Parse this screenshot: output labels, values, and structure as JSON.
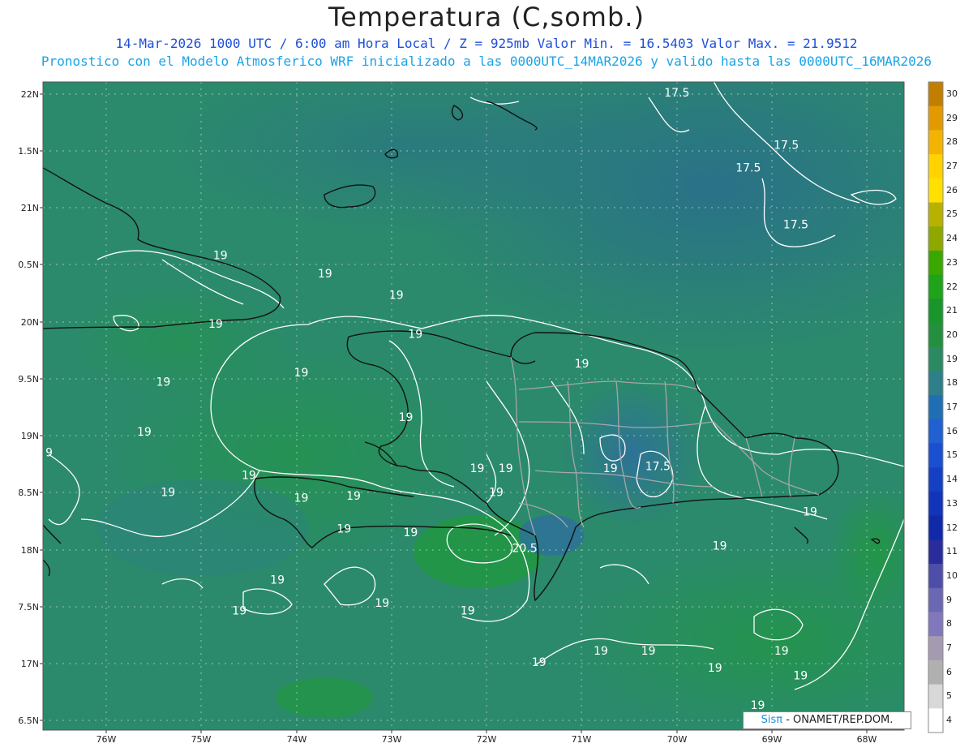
{
  "header": {
    "title": "Temperatura (C,somb.)",
    "subtitle_line1": "14-Mar-2026  1000 UTC / 6:00 am Hora Local / Z = 925mb    Valor Min. = 16.5403  Valor Max. = 21.9512",
    "subtitle_line2": "Pronostico con el Modelo Atmosferico WRF inicializado a las 0000UTC_14MAR2026 y valido hasta las  0000UTC_16MAR2026"
  },
  "map": {
    "lat_labels": [
      "22N",
      "1.5N",
      "21N",
      "0.5N",
      "20N",
      "9.5N",
      "19N",
      "8.5N",
      "18N",
      "7.5N",
      "17N",
      "6.5N"
    ],
    "lon_labels": [
      "76W",
      "75W",
      "74W",
      "73W",
      "72W",
      "71W",
      "70W",
      "69W",
      "68W"
    ],
    "contour_labels": [
      {
        "text": "17.5",
        "lon": -70.0,
        "lat": 21.98
      },
      {
        "text": "17.5",
        "lon": -68.85,
        "lat": 21.52
      },
      {
        "text": "17.5",
        "lon": -69.25,
        "lat": 21.32
      },
      {
        "text": "17.5",
        "lon": -68.75,
        "lat": 20.82
      },
      {
        "text": "19",
        "lon": -74.8,
        "lat": 20.55
      },
      {
        "text": "19",
        "lon": -73.7,
        "lat": 20.39
      },
      {
        "text": "19",
        "lon": -72.95,
        "lat": 20.2
      },
      {
        "text": "19",
        "lon": -74.85,
        "lat": 19.95
      },
      {
        "text": "19",
        "lon": -72.75,
        "lat": 19.86
      },
      {
        "text": "19",
        "lon": -71.0,
        "lat": 19.6
      },
      {
        "text": "19",
        "lon": -73.95,
        "lat": 19.52
      },
      {
        "text": "19",
        "lon": -75.4,
        "lat": 19.44
      },
      {
        "text": "19",
        "lon": -72.85,
        "lat": 19.13
      },
      {
        "text": "19",
        "lon": -75.6,
        "lat": 19.0
      },
      {
        "text": "19",
        "lon": -72.1,
        "lat": 18.68
      },
      {
        "text": "19",
        "lon": -71.8,
        "lat": 18.68
      },
      {
        "text": "19",
        "lon": -70.7,
        "lat": 18.68
      },
      {
        "text": "17.5",
        "lon": -70.2,
        "lat": 18.7
      },
      {
        "text": "19",
        "lon": -74.5,
        "lat": 18.62
      },
      {
        "text": "19",
        "lon": -75.35,
        "lat": 18.47
      },
      {
        "text": "19",
        "lon": -73.95,
        "lat": 18.42
      },
      {
        "text": "19",
        "lon": -73.4,
        "lat": 18.44
      },
      {
        "text": "19",
        "lon": -71.9,
        "lat": 18.47
      },
      {
        "text": "19",
        "lon": -73.5,
        "lat": 18.15
      },
      {
        "text": "19",
        "lon": -72.8,
        "lat": 18.12
      },
      {
        "text": "19",
        "lon": -68.6,
        "lat": 18.3
      },
      {
        "text": "20.5",
        "lon": -71.6,
        "lat": 17.98
      },
      {
        "text": "19",
        "lon": -69.55,
        "lat": 18.0
      },
      {
        "text": "19",
        "lon": -74.2,
        "lat": 17.7
      },
      {
        "text": "19",
        "lon": -73.1,
        "lat": 17.5
      },
      {
        "text": "19",
        "lon": -74.6,
        "lat": 17.43
      },
      {
        "text": "19",
        "lon": -72.2,
        "lat": 17.43
      },
      {
        "text": "19",
        "lon": -70.8,
        "lat": 17.08
      },
      {
        "text": "19",
        "lon": -70.3,
        "lat": 17.08
      },
      {
        "text": "19",
        "lon": -68.9,
        "lat": 17.08
      },
      {
        "text": "19",
        "lon": -71.45,
        "lat": 16.98
      },
      {
        "text": "19",
        "lon": -69.6,
        "lat": 16.93
      },
      {
        "text": "19",
        "lon": -68.7,
        "lat": 16.86
      },
      {
        "text": "19",
        "lon": -69.15,
        "lat": 16.6
      },
      {
        "text": "9",
        "lon": -76.6,
        "lat": 18.82
      }
    ]
  },
  "colorbar": {
    "labels": [
      "30",
      "29",
      "28",
      "27",
      "26",
      "25",
      "24",
      "23",
      "22",
      "21",
      "20",
      "19",
      "18",
      "17",
      "16",
      "15",
      "14",
      "13",
      "12",
      "11",
      "10",
      "9",
      "8",
      "7",
      "6",
      "5",
      "4"
    ],
    "colors": [
      "#c27e00",
      "#e29a00",
      "#f4b300",
      "#ffd200",
      "#ffe000",
      "#b7b100",
      "#8fa800",
      "#3aa800",
      "#1ea31a",
      "#19952c",
      "#22903f",
      "#2c8a62",
      "#2e7f8a",
      "#1f6fb4",
      "#2060d0",
      "#1a4fcf",
      "#1540c4",
      "#1234b8",
      "#0f29a8",
      "#2a2c9c",
      "#4e4ea8",
      "#6a68b3",
      "#8078bb",
      "#a49bb0",
      "#b0b0b0",
      "#d8d8d8",
      "#ffffff"
    ]
  },
  "credit": {
    "logo": "Sisπ",
    "org": " - ONAMET/REP.DOM."
  }
}
